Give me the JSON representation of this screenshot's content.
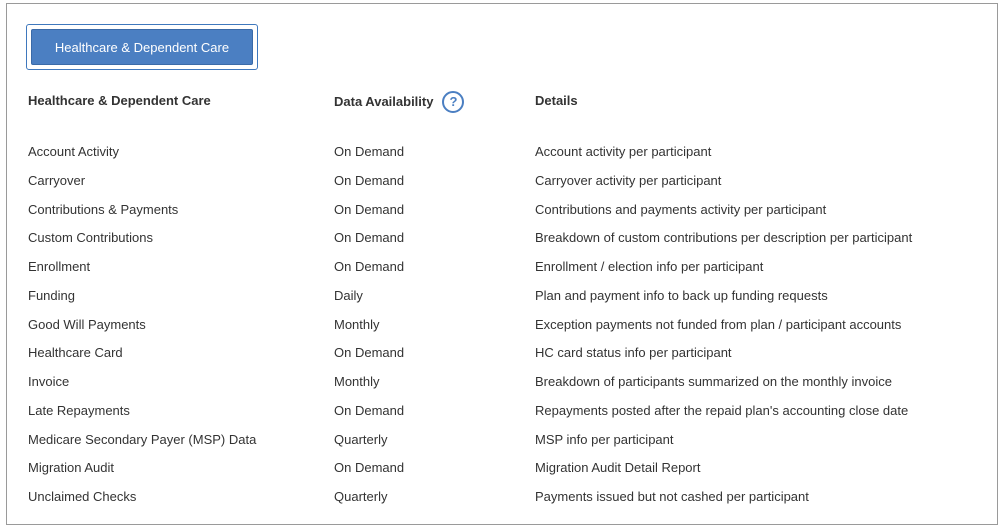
{
  "tab": {
    "label": "Healthcare & Dependent Care"
  },
  "columns": {
    "report": "Healthcare & Dependent Care",
    "availability": "Data Availability",
    "details": "Details",
    "help_icon": "?"
  },
  "rows": [
    {
      "report": "Account Activity",
      "availability": "On Demand",
      "details": "Account activity per participant"
    },
    {
      "report": "Carryover",
      "availability": "On Demand",
      "details": "Carryover activity per participant"
    },
    {
      "report": "Contributions & Payments",
      "availability": "On Demand",
      "details": "Contributions and payments activity per participant"
    },
    {
      "report": "Custom Contributions",
      "availability": "On Demand",
      "details": "Breakdown of custom contributions per description per participant"
    },
    {
      "report": "Enrollment",
      "availability": "On Demand",
      "details": "Enrollment / election info per participant"
    },
    {
      "report": "Funding",
      "availability": "Daily",
      "details": "Plan and payment info to back up funding requests"
    },
    {
      "report": "Good Will Payments",
      "availability": "Monthly",
      "details": "Exception payments not funded from plan / participant accounts"
    },
    {
      "report": "Healthcare Card",
      "availability": "On Demand",
      "details": "HC card status info per participant"
    },
    {
      "report": "Invoice",
      "availability": "Monthly",
      "details": "Breakdown of participants summarized on the monthly invoice"
    },
    {
      "report": "Late Repayments",
      "availability": "On Demand",
      "details": "Repayments posted after the repaid plan's accounting close date"
    },
    {
      "report": "Medicare Secondary Payer (MSP) Data",
      "availability": "Quarterly",
      "details": "MSP info per participant"
    },
    {
      "report": "Migration Audit",
      "availability": "On Demand",
      "details": "Migration Audit Detail Report"
    },
    {
      "report": "Unclaimed Checks",
      "availability": "Quarterly",
      "details": "Payments issued but not cashed per participant"
    }
  ],
  "colors": {
    "accent": "#4b7fc2",
    "text": "#333333",
    "border": "#9a9a9a"
  }
}
